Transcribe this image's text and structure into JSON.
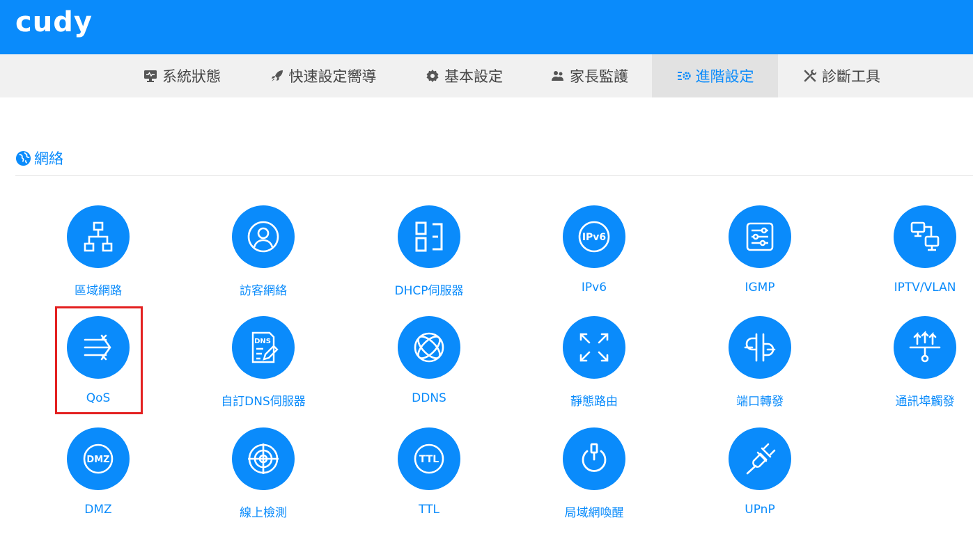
{
  "brand": {
    "logo_text": "cudy",
    "accent": "#0a8bfb"
  },
  "nav": {
    "items": [
      {
        "label": "系統狀態",
        "icon": "monitor-icon",
        "active": false
      },
      {
        "label": "快速設定嚮導",
        "icon": "rocket-icon",
        "active": false
      },
      {
        "label": "基本設定",
        "icon": "gear-icon",
        "active": false
      },
      {
        "label": "家長監護",
        "icon": "users-icon",
        "active": false
      },
      {
        "label": "進階設定",
        "icon": "advanced-settings-icon",
        "active": true
      },
      {
        "label": "診斷工具",
        "icon": "tools-icon",
        "active": false
      }
    ]
  },
  "section": {
    "title": "網絡",
    "icon": "globe-icon"
  },
  "tiles": [
    {
      "label": "區域網路",
      "icon": "lan-icon"
    },
    {
      "label": "訪客網絡",
      "icon": "guest-icon"
    },
    {
      "label": "DHCP伺服器",
      "icon": "dhcp-icon"
    },
    {
      "label": "IPv6",
      "icon": "ipv6-icon"
    },
    {
      "label": "IGMP",
      "icon": "igmp-icon"
    },
    {
      "label": "IPTV/VLAN",
      "icon": "iptv-icon"
    },
    {
      "label": "QoS",
      "icon": "qos-icon",
      "highlighted": true
    },
    {
      "label": "自訂DNS伺服器",
      "icon": "dns-icon"
    },
    {
      "label": "DDNS",
      "icon": "ddns-icon"
    },
    {
      "label": "靜態路由",
      "icon": "static-route-icon"
    },
    {
      "label": "端口轉發",
      "icon": "port-forward-icon"
    },
    {
      "label": "通訊埠觸發",
      "icon": "port-trigger-icon"
    },
    {
      "label": "DMZ",
      "icon": "dmz-icon"
    },
    {
      "label": "線上檢測",
      "icon": "online-detection-icon"
    },
    {
      "label": "TTL",
      "icon": "ttl-icon"
    },
    {
      "label": "局域網喚醒",
      "icon": "wake-on-lan-icon"
    },
    {
      "label": "UPnP",
      "icon": "upnp-icon"
    }
  ],
  "icon_text": {
    "ipv6": "IPv6",
    "dns": "DNS",
    "dmz": "DMZ",
    "ttl": "TTL"
  }
}
